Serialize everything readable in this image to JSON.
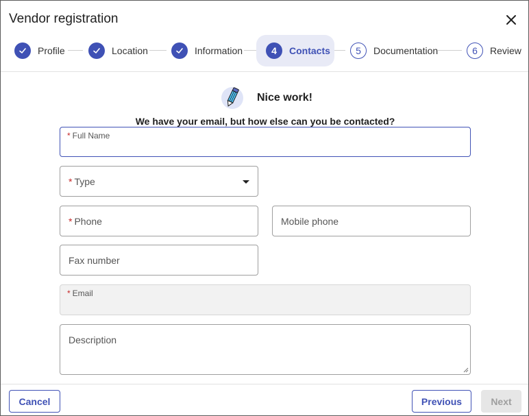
{
  "dialog": {
    "title": "Vendor registration"
  },
  "stepper": {
    "steps": [
      {
        "number": "",
        "label": "Profile",
        "state": "done"
      },
      {
        "number": "",
        "label": "Location",
        "state": "done"
      },
      {
        "number": "",
        "label": "Information",
        "state": "done"
      },
      {
        "number": "4",
        "label": "Contacts",
        "state": "active"
      },
      {
        "number": "5",
        "label": "Documentation",
        "state": "todo"
      },
      {
        "number": "6",
        "label": "Review",
        "state": "todo"
      }
    ]
  },
  "intro": {
    "heading": "Nice work!",
    "subtitle": "We have your email, but how else can you be contacted?"
  },
  "form": {
    "required_mark": "*",
    "full_name": {
      "label": "Full Name",
      "value": ""
    },
    "type": {
      "label": "Type",
      "value": ""
    },
    "phone": {
      "label": "Phone",
      "value": ""
    },
    "mobile_phone": {
      "label": "Mobile phone",
      "value": ""
    },
    "fax_number": {
      "label": "Fax number",
      "value": ""
    },
    "email": {
      "label": "Email",
      "value": ""
    },
    "description": {
      "label": "Description",
      "value": ""
    }
  },
  "footer": {
    "cancel_label": "Cancel",
    "previous_label": "Previous",
    "next_label": "Next"
  },
  "colors": {
    "accent": "#3f51b5",
    "active_step_bg": "#e8eaf6",
    "required": "#c62828",
    "disabled_bg": "#e6e6e6"
  },
  "icons": {
    "close": "close-icon",
    "check": "check-icon",
    "pencil": "pencil-icon",
    "dropdown": "chevron-down-icon"
  }
}
